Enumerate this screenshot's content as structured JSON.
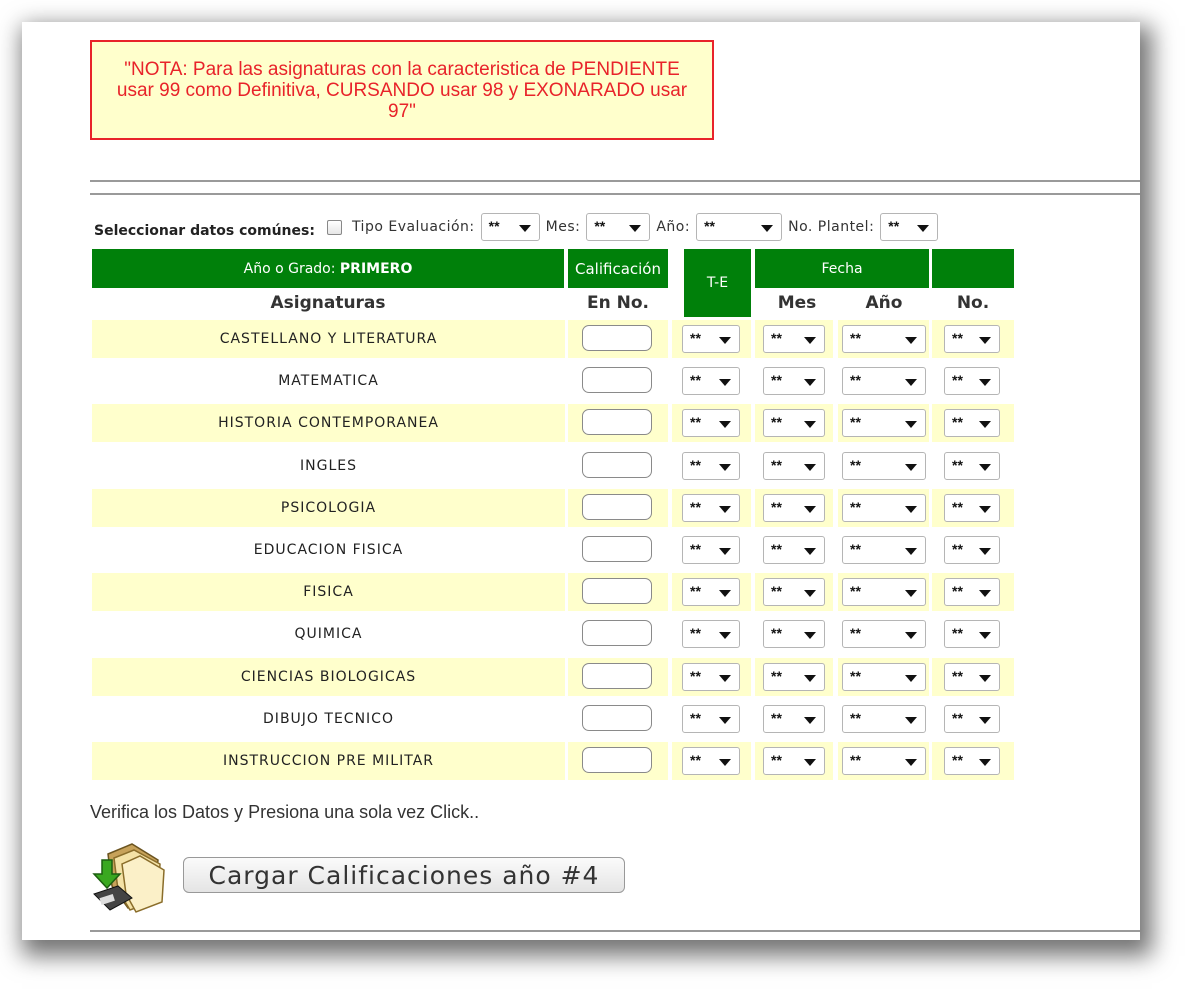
{
  "note": "\"NOTA: Para las asignaturas con la caracteristica de PENDIENTE usar 99 como Definitiva, CURSANDO usar 98 y EXONARADO usar 97\"",
  "common": {
    "label": "Seleccionar datos comúnes:",
    "tipo_label": "Tipo Evaluación:",
    "tipo_value": "**",
    "mes_label": "Mes:",
    "mes_value": "**",
    "anio_label": "Año:",
    "anio_value": "**",
    "plantel_label": "No. Plantel:",
    "plantel_value": "**"
  },
  "table": {
    "grade_prefix": "Año o Grado: ",
    "grade_value": "PRIMERO",
    "calificacion": "Calificación",
    "te": "T-E",
    "fecha": "Fecha",
    "asignaturas": "Asignaturas",
    "en_no": "En No.",
    "mes": "Mes",
    "anio": "Año",
    "no": "No.",
    "select_default": "**",
    "subjects": [
      "CASTELLANO Y LITERATURA",
      "MATEMATICA",
      "HISTORIA CONTEMPORANEA",
      "INGLES",
      "PSICOLOGIA",
      "EDUCACION FISICA",
      "FISICA",
      "QUIMICA",
      "CIENCIAS BIOLOGICAS",
      "DIBUJO TECNICO",
      "INSTRUCCION PRE MILITAR"
    ]
  },
  "verify_text": "Verifica los Datos y Presiona una sola vez Click..",
  "submit_label": "Cargar Calificaciones año #4",
  "colors": {
    "header_green": "#00800a",
    "row_shade": "#ffffcc",
    "note_red": "#e8232a"
  }
}
